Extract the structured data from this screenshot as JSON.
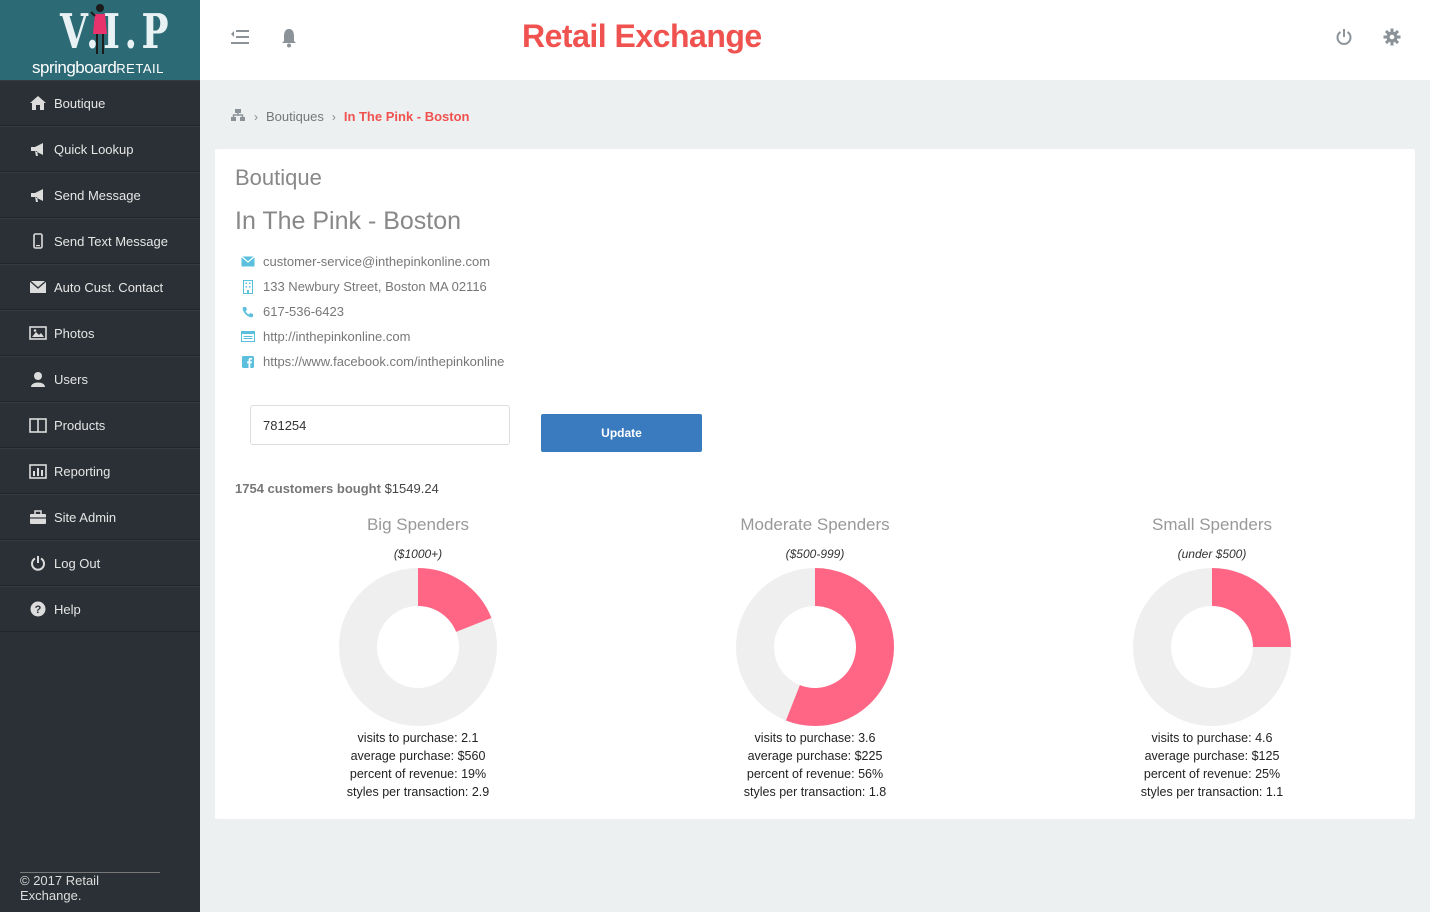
{
  "logo": {
    "letters": "V.I.P",
    "brand": "springboard",
    "brand_suffix": "RETAIL"
  },
  "sidebar": {
    "items": [
      {
        "label": "Boutique",
        "icon": "home-icon"
      },
      {
        "label": "Quick Lookup",
        "icon": "megaphone-icon"
      },
      {
        "label": "Send Message",
        "icon": "megaphone-icon"
      },
      {
        "label": "Send Text Message",
        "icon": "mobile-phone-icon"
      },
      {
        "label": "Auto Cust. Contact",
        "icon": "envelope-icon"
      },
      {
        "label": "Photos",
        "icon": "picture-icon"
      },
      {
        "label": "Users",
        "icon": "user-icon"
      },
      {
        "label": "Products",
        "icon": "columns-icon"
      },
      {
        "label": "Reporting",
        "icon": "bar-chart-icon"
      },
      {
        "label": "Site Admin",
        "icon": "briefcase-icon"
      },
      {
        "label": "Log Out",
        "icon": "power-icon"
      },
      {
        "label": "Help",
        "icon": "question-circle-icon"
      }
    ],
    "footer": "© 2017 Retail Exchange."
  },
  "header": {
    "title": "Retail Exchange",
    "title_color": "#f0524f"
  },
  "breadcrumb": {
    "parent": "Boutiques",
    "current": "In The Pink - Boston"
  },
  "boutique": {
    "section_title": "Boutique",
    "name": "In The Pink - Boston",
    "email": "customer-service@inthepinkonline.com",
    "address": "133 Newbury Street, Boston MA 02116",
    "phone": "617-536-6423",
    "website": "http://inthepinkonline.com",
    "facebook": "https://www.facebook.com/inthepinkonline"
  },
  "form": {
    "input_value": "781254",
    "update_label": "Update"
  },
  "summary": {
    "customers": "1754 customers bought",
    "amount": "$1549.24"
  },
  "colors": {
    "accent": "#f0524f",
    "donut_fill": "#ff6685",
    "donut_track": "#efefef",
    "button": "#3a7bbf",
    "sidebar": "#2a3035"
  },
  "chart_data": [
    {
      "type": "pie",
      "title": "Big Spenders",
      "subtitle": "($1000+)",
      "value_fraction": 0.19,
      "stats": [
        "visits to purchase: 2.1",
        "average purchase: $560",
        "percent of revenue: 19%",
        "styles per transaction: 2.9"
      ]
    },
    {
      "type": "pie",
      "title": "Moderate Spenders",
      "subtitle": "($500-999)",
      "value_fraction": 0.56,
      "stats": [
        "visits to purchase: 3.6",
        "average purchase: $225",
        "percent of revenue: 56%",
        "styles per transaction: 1.8"
      ]
    },
    {
      "type": "pie",
      "title": "Small Spenders",
      "subtitle": "(under $500)",
      "value_fraction": 0.25,
      "stats": [
        "visits to purchase: 4.6",
        "average purchase: $125",
        "percent of revenue: 25%",
        "styles per transaction: 1.1"
      ]
    }
  ]
}
